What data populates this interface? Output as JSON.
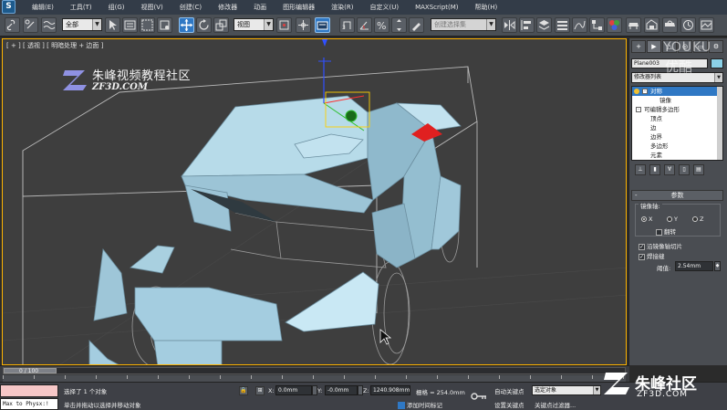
{
  "menubar": {
    "items": [
      "编辑(E)",
      "工具(T)",
      "组(G)",
      "视图(V)",
      "创建(C)",
      "修改器",
      "动画",
      "图形编辑器",
      "渲染(R)",
      "自定义(U)",
      "MAXScript(M)",
      "帮助(H)"
    ]
  },
  "toolbar": {
    "selection_filter": "全部",
    "reference_coord": "视图",
    "named_selection_placeholder": "创建选择集"
  },
  "viewport": {
    "label": "[ + ] [ 透视 ] [ 明暗处理 + 边面 ]",
    "border_color": "#ffb400"
  },
  "logo": {
    "cn": "朱峰视频教程社区",
    "en": "ZF3D.COM"
  },
  "command_panel": {
    "tabs": [
      "+",
      "▶",
      "△",
      "◎",
      "▭",
      "⚙"
    ],
    "object_name": "Plane003",
    "object_color": "#8bd0e6",
    "modifier_list": "修改器列表",
    "stack": [
      {
        "label": "对称",
        "selected": true,
        "indent": 0
      },
      {
        "label": "镜像",
        "selected": false,
        "indent": 2
      },
      {
        "label": "可编辑多边形",
        "selected": false,
        "indent": 0
      },
      {
        "label": "顶点",
        "selected": false,
        "indent": 2
      },
      {
        "label": "边",
        "selected": false,
        "indent": 2
      },
      {
        "label": "边界",
        "selected": false,
        "indent": 2
      },
      {
        "label": "多边形",
        "selected": false,
        "indent": 2
      },
      {
        "label": "元素",
        "selected": false,
        "indent": 2
      }
    ],
    "rollout_title": "参数",
    "mirror_axis_label": "镜像轴:",
    "axes": [
      {
        "label": "X",
        "checked": true
      },
      {
        "label": "Y",
        "checked": false
      },
      {
        "label": "Z",
        "checked": false
      }
    ],
    "flip_label": "翻转",
    "flip_checked": false,
    "slice_label": "沿镜像轴切片",
    "slice_checked": true,
    "weld_label": "焊接缝",
    "weld_checked": true,
    "threshold_label": "阈值:",
    "threshold_value": "2.54mm"
  },
  "timeline": {
    "frame_label": "0 / 100"
  },
  "status": {
    "maxscript_text": "Max to Physx:!",
    "selection": "选择了 1 个对象",
    "prompt": "单击并拖动以选择并移动对象",
    "x_label": "X:",
    "x_value": "0.0mm",
    "y_label": "Y:",
    "y_value": "-0.0mm",
    "z_label": "Z:",
    "z_value": "1240.908mm",
    "grid": "栅格 = 254.0mm",
    "add_tag": "添加时间标记",
    "autokey": "自动关键点",
    "setkey": "设置关键点",
    "selected_object": "选定对象",
    "key_filter": "关键点过滤器..."
  },
  "watermarks": {
    "youku_1": "YOUKU",
    "youku_2": "优酷",
    "zf_cn": "朱峰社区",
    "zf_en": "ZF3D.COM"
  }
}
